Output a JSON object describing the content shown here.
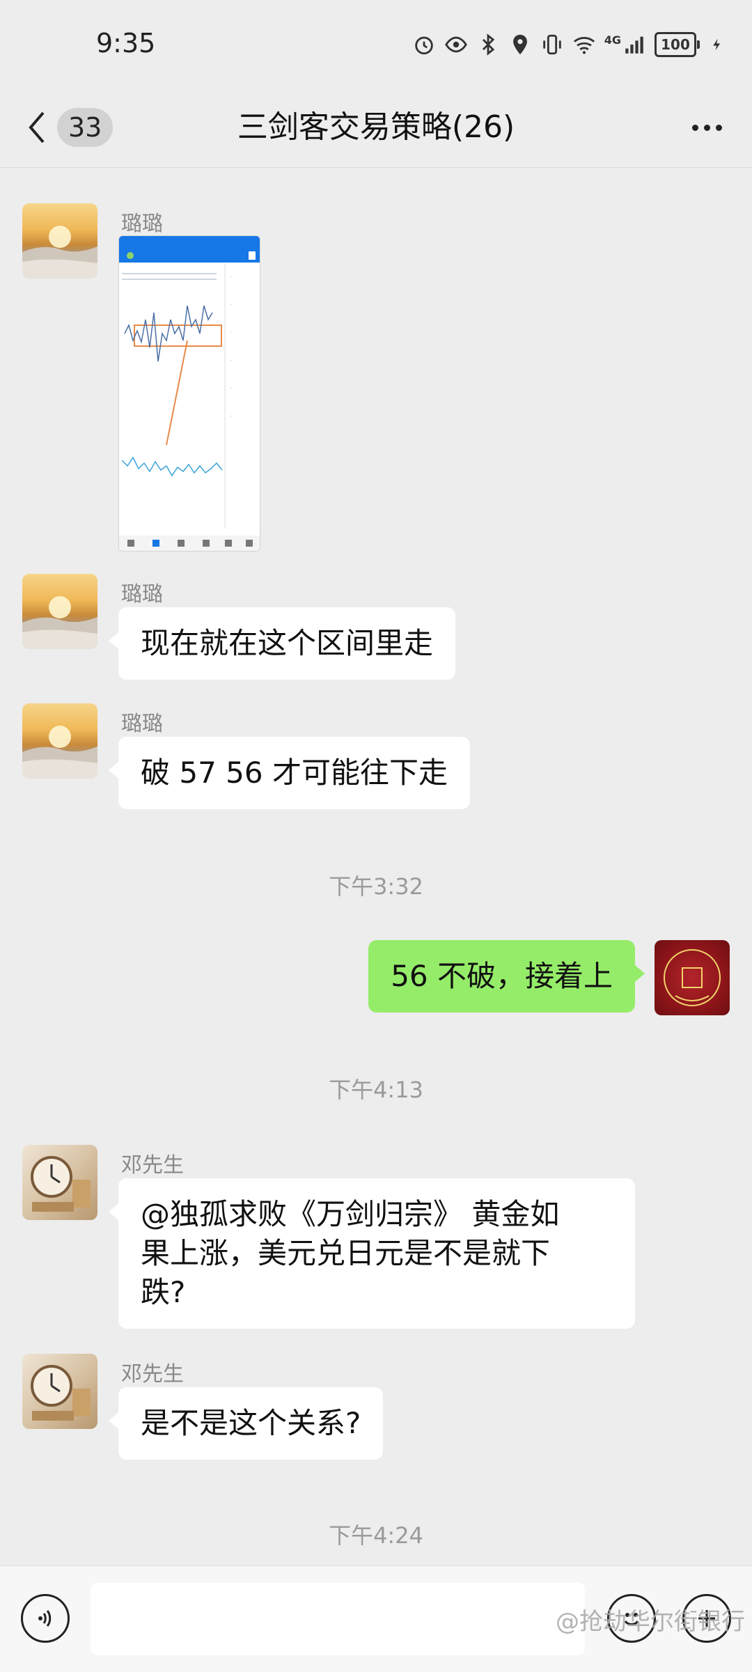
{
  "status_bar": {
    "time": "9:35",
    "network": "4G",
    "battery": "100"
  },
  "nav": {
    "unread_count": "33",
    "title": "三剑客交易策略(26)"
  },
  "messages": [
    {
      "sender": "璐璐",
      "type": "image"
    },
    {
      "sender": "璐璐",
      "text": "现在就在这个区间里走"
    },
    {
      "sender": "璐璐",
      "text": "破 57 56 才可能往下走"
    },
    {
      "timestamp": "下午3:32"
    },
    {
      "sender": "me",
      "text": "56 不破，接着上"
    },
    {
      "timestamp": "下午4:13"
    },
    {
      "sender": "邓先生",
      "text_lines": [
        "@独孤求败《万剑归宗》 黄金如",
        "果上涨，美元兑日元是不是就下",
        "跌?"
      ]
    },
    {
      "sender": "邓先生",
      "text": "是不是这个关系?"
    },
    {
      "timestamp": "下午4:24"
    }
  ],
  "input": {
    "placeholder": ""
  },
  "watermark": "@抢劫华尔街银行"
}
